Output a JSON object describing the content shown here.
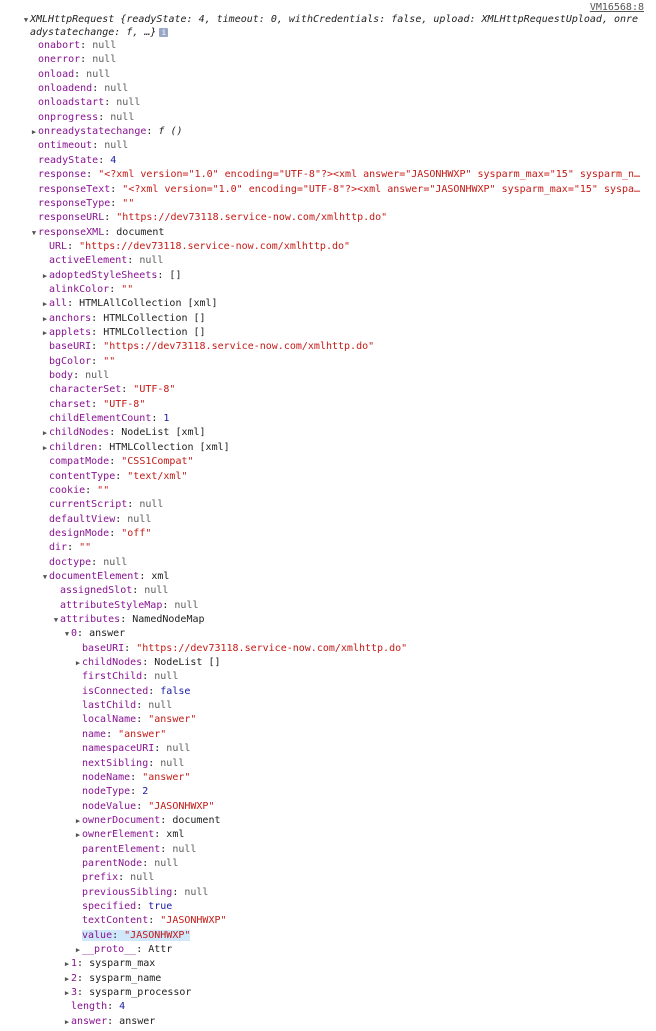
{
  "source_link": "VM16568:8",
  "summary": {
    "line1": "XMLHttpRequest {readyState: 4, timeout: 0, withCredentials: false, upload: XMLHttpRequestUpload, onre",
    "line2": "adystatechange: f, …}",
    "info_icon": "i"
  },
  "rows": [
    {
      "d": 1,
      "arrow": "",
      "key": "onabort",
      "val": "null",
      "vt": "n"
    },
    {
      "d": 1,
      "arrow": "",
      "key": "onerror",
      "val": "null",
      "vt": "n"
    },
    {
      "d": 1,
      "arrow": "",
      "key": "onload",
      "val": "null",
      "vt": "n"
    },
    {
      "d": 1,
      "arrow": "",
      "key": "onloadend",
      "val": "null",
      "vt": "n"
    },
    {
      "d": 1,
      "arrow": "",
      "key": "onloadstart",
      "val": "null",
      "vt": "n"
    },
    {
      "d": 1,
      "arrow": "",
      "key": "onprogress",
      "val": "null",
      "vt": "n"
    },
    {
      "d": 1,
      "arrow": "right",
      "key": "onreadystatechange",
      "val": "f ()",
      "vt": "fn"
    },
    {
      "d": 1,
      "arrow": "",
      "key": "ontimeout",
      "val": "null",
      "vt": "n"
    },
    {
      "d": 1,
      "arrow": "",
      "key": "readyState",
      "val": "4",
      "vt": "num"
    },
    {
      "d": 1,
      "arrow": "",
      "key": "response",
      "val": "\"<?xml version=\"1.0\" encoding=\"UTF-8\"?><xml answer=\"JASONHWXP\" sysparm_max=\"15\" sysparm_n…",
      "vt": "s"
    },
    {
      "d": 1,
      "arrow": "",
      "key": "responseText",
      "val": "\"<?xml version=\"1.0\" encoding=\"UTF-8\"?><xml answer=\"JASONHWXP\" sysparm_max=\"15\" syspa…",
      "vt": "s"
    },
    {
      "d": 1,
      "arrow": "",
      "key": "responseType",
      "val": "\"\"",
      "vt": "s"
    },
    {
      "d": 1,
      "arrow": "",
      "key": "responseURL",
      "val": "\"https://dev73118.service-now.com/xmlhttp.do\"",
      "vt": "s"
    },
    {
      "d": 1,
      "arrow": "down",
      "key": "responseXML",
      "val": "document",
      "vt": "t"
    },
    {
      "d": 2,
      "arrow": "",
      "key": "URL",
      "val": "\"https://dev73118.service-now.com/xmlhttp.do\"",
      "vt": "s"
    },
    {
      "d": 2,
      "arrow": "",
      "key": "activeElement",
      "val": "null",
      "vt": "n"
    },
    {
      "d": 2,
      "arrow": "right",
      "key": "adoptedStyleSheets",
      "val": "[]",
      "vt": "t"
    },
    {
      "d": 2,
      "arrow": "",
      "key": "alinkColor",
      "val": "\"\"",
      "vt": "s"
    },
    {
      "d": 2,
      "arrow": "right",
      "key": "all",
      "val": "HTMLAllCollection [xml]",
      "vt": "t"
    },
    {
      "d": 2,
      "arrow": "right",
      "key": "anchors",
      "val": "HTMLCollection []",
      "vt": "t"
    },
    {
      "d": 2,
      "arrow": "right",
      "key": "applets",
      "val": "HTMLCollection []",
      "vt": "t"
    },
    {
      "d": 2,
      "arrow": "",
      "key": "baseURI",
      "val": "\"https://dev73118.service-now.com/xmlhttp.do\"",
      "vt": "s"
    },
    {
      "d": 2,
      "arrow": "",
      "key": "bgColor",
      "val": "\"\"",
      "vt": "s"
    },
    {
      "d": 2,
      "arrow": "",
      "key": "body",
      "val": "null",
      "vt": "n"
    },
    {
      "d": 2,
      "arrow": "",
      "key": "characterSet",
      "val": "\"UTF-8\"",
      "vt": "s"
    },
    {
      "d": 2,
      "arrow": "",
      "key": "charset",
      "val": "\"UTF-8\"",
      "vt": "s"
    },
    {
      "d": 2,
      "arrow": "",
      "key": "childElementCount",
      "val": "1",
      "vt": "num"
    },
    {
      "d": 2,
      "arrow": "right",
      "key": "childNodes",
      "val": "NodeList [xml]",
      "vt": "t"
    },
    {
      "d": 2,
      "arrow": "right",
      "key": "children",
      "val": "HTMLCollection [xml]",
      "vt": "t"
    },
    {
      "d": 2,
      "arrow": "",
      "key": "compatMode",
      "val": "\"CSS1Compat\"",
      "vt": "s"
    },
    {
      "d": 2,
      "arrow": "",
      "key": "contentType",
      "val": "\"text/xml\"",
      "vt": "s"
    },
    {
      "d": 2,
      "arrow": "",
      "key": "cookie",
      "val": "\"\"",
      "vt": "s"
    },
    {
      "d": 2,
      "arrow": "",
      "key": "currentScript",
      "val": "null",
      "vt": "n"
    },
    {
      "d": 2,
      "arrow": "",
      "key": "defaultView",
      "val": "null",
      "vt": "n"
    },
    {
      "d": 2,
      "arrow": "",
      "key": "designMode",
      "val": "\"off\"",
      "vt": "s"
    },
    {
      "d": 2,
      "arrow": "",
      "key": "dir",
      "val": "\"\"",
      "vt": "s"
    },
    {
      "d": 2,
      "arrow": "",
      "key": "doctype",
      "val": "null",
      "vt": "n"
    },
    {
      "d": 2,
      "arrow": "down",
      "key": "documentElement",
      "val": "xml",
      "vt": "t"
    },
    {
      "d": 3,
      "arrow": "",
      "key": "assignedSlot",
      "val": "null",
      "vt": "n"
    },
    {
      "d": 3,
      "arrow": "",
      "key": "attributeStyleMap",
      "val": "null",
      "vt": "n"
    },
    {
      "d": 3,
      "arrow": "down",
      "key": "attributes",
      "val": "NamedNodeMap",
      "vt": "t"
    },
    {
      "d": 4,
      "arrow": "down",
      "key": "0",
      "val": "answer",
      "vt": "t"
    },
    {
      "d": 5,
      "arrow": "",
      "key": "baseURI",
      "val": "\"https://dev73118.service-now.com/xmlhttp.do\"",
      "vt": "s"
    },
    {
      "d": 5,
      "arrow": "right",
      "key": "childNodes",
      "val": "NodeList []",
      "vt": "t"
    },
    {
      "d": 5,
      "arrow": "",
      "key": "firstChild",
      "val": "null",
      "vt": "n"
    },
    {
      "d": 5,
      "arrow": "",
      "key": "isConnected",
      "val": "false",
      "vt": "b"
    },
    {
      "d": 5,
      "arrow": "",
      "key": "lastChild",
      "val": "null",
      "vt": "n"
    },
    {
      "d": 5,
      "arrow": "",
      "key": "localName",
      "val": "\"answer\"",
      "vt": "s"
    },
    {
      "d": 5,
      "arrow": "",
      "key": "name",
      "val": "\"answer\"",
      "vt": "s"
    },
    {
      "d": 5,
      "arrow": "",
      "key": "namespaceURI",
      "val": "null",
      "vt": "n"
    },
    {
      "d": 5,
      "arrow": "",
      "key": "nextSibling",
      "val": "null",
      "vt": "n"
    },
    {
      "d": 5,
      "arrow": "",
      "key": "nodeName",
      "val": "\"answer\"",
      "vt": "s"
    },
    {
      "d": 5,
      "arrow": "",
      "key": "nodeType",
      "val": "2",
      "vt": "num"
    },
    {
      "d": 5,
      "arrow": "",
      "key": "nodeValue",
      "val": "\"JASONHWXP\"",
      "vt": "s"
    },
    {
      "d": 5,
      "arrow": "right",
      "key": "ownerDocument",
      "val": "document",
      "vt": "t"
    },
    {
      "d": 5,
      "arrow": "right",
      "key": "ownerElement",
      "val": "xml",
      "vt": "t"
    },
    {
      "d": 5,
      "arrow": "",
      "key": "parentElement",
      "val": "null",
      "vt": "n"
    },
    {
      "d": 5,
      "arrow": "",
      "key": "parentNode",
      "val": "null",
      "vt": "n"
    },
    {
      "d": 5,
      "arrow": "",
      "key": "prefix",
      "val": "null",
      "vt": "n"
    },
    {
      "d": 5,
      "arrow": "",
      "key": "previousSibling",
      "val": "null",
      "vt": "n"
    },
    {
      "d": 5,
      "arrow": "",
      "key": "specified",
      "val": "true",
      "vt": "b"
    },
    {
      "d": 5,
      "arrow": "",
      "key": "textContent",
      "val": "\"JASONHWXP\"",
      "vt": "s"
    },
    {
      "d": 5,
      "arrow": "",
      "key": "value",
      "val": "\"JASONHWXP\"",
      "vt": "s",
      "hl": true
    },
    {
      "d": 5,
      "arrow": "right",
      "key": "__proto__",
      "val": "Attr",
      "vt": "t"
    },
    {
      "d": 4,
      "arrow": "right",
      "key": "1",
      "val": "sysparm_max",
      "vt": "t"
    },
    {
      "d": 4,
      "arrow": "right",
      "key": "2",
      "val": "sysparm_name",
      "vt": "t"
    },
    {
      "d": 4,
      "arrow": "right",
      "key": "3",
      "val": "sysparm_processor",
      "vt": "t"
    },
    {
      "d": 4,
      "arrow": "",
      "key": "length",
      "val": "4",
      "vt": "num"
    },
    {
      "d": 4,
      "arrow": "right",
      "key": "answer",
      "val": "answer",
      "vt": "t"
    }
  ]
}
